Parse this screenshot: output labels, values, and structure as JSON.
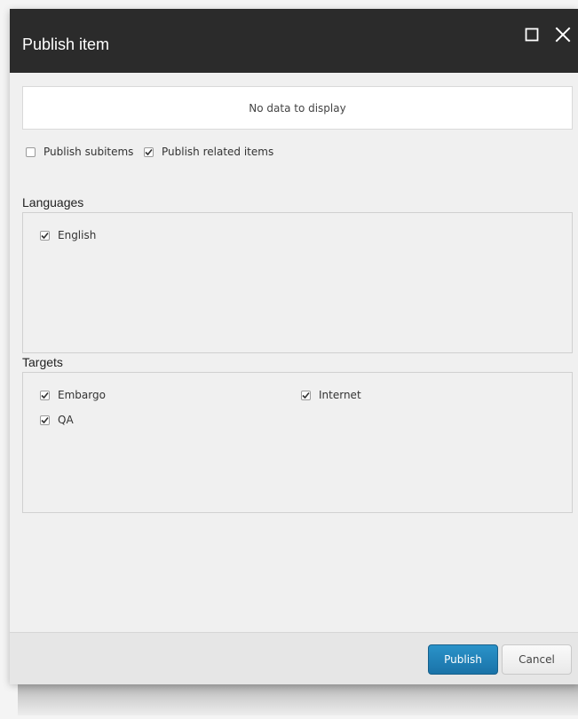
{
  "dialog": {
    "title": "Publish item",
    "maximize_icon": "maximize-icon",
    "close_icon": "close-icon"
  },
  "grid": {
    "empty_text": "No data to display"
  },
  "options": {
    "publish_subitems": {
      "label": "Publish subitems",
      "checked": false
    },
    "publish_related": {
      "label": "Publish related items",
      "checked": true
    }
  },
  "languages": {
    "heading": "Languages",
    "items": [
      {
        "label": "English",
        "checked": true
      }
    ]
  },
  "targets": {
    "heading": "Targets",
    "items": [
      {
        "label": "Embargo",
        "checked": true
      },
      {
        "label": "Internet",
        "checked": true
      },
      {
        "label": "QA",
        "checked": true
      }
    ]
  },
  "footer": {
    "publish_label": "Publish",
    "cancel_label": "Cancel"
  },
  "colors": {
    "header_bg": "#2b2b2b",
    "primary_button": "#1f80b8",
    "dialog_bg": "#f0f0f0"
  }
}
